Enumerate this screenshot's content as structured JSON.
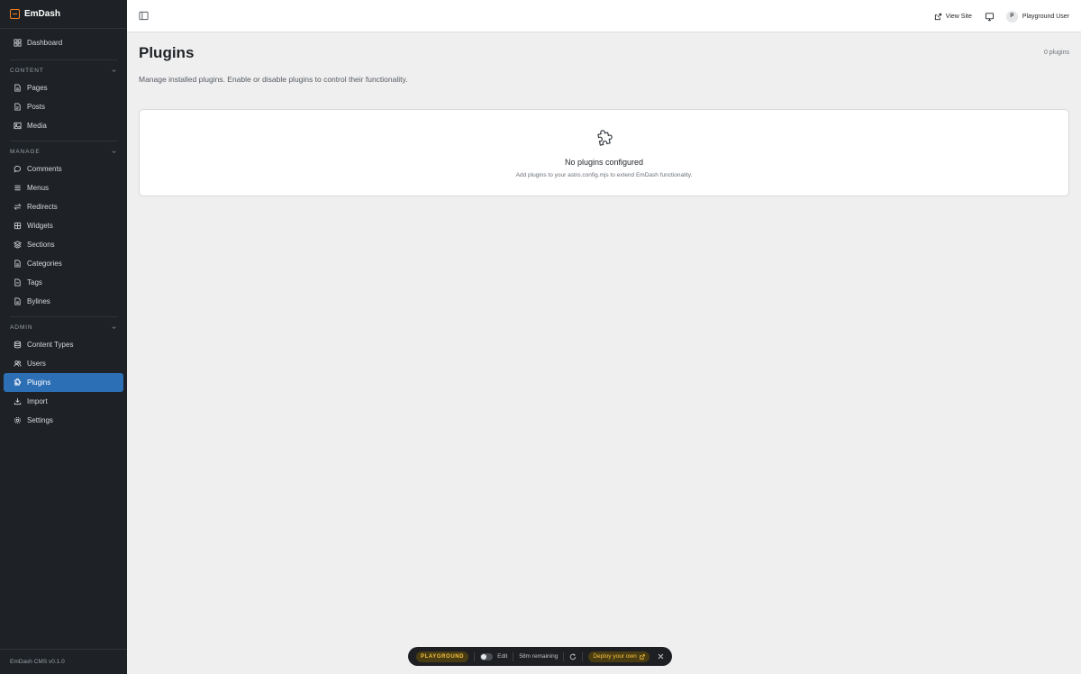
{
  "brand": {
    "name": "EmDash"
  },
  "sidebar": {
    "top_items": [
      {
        "label": "Dashboard",
        "icon": "dashboard-grid-icon"
      }
    ],
    "sections": [
      {
        "title": "CONTENT",
        "items": [
          {
            "label": "Pages",
            "icon": "page-icon"
          },
          {
            "label": "Posts",
            "icon": "post-icon"
          },
          {
            "label": "Media",
            "icon": "image-icon"
          }
        ]
      },
      {
        "title": "MANAGE",
        "items": [
          {
            "label": "Comments",
            "icon": "comment-icon"
          },
          {
            "label": "Menus",
            "icon": "menu-icon"
          },
          {
            "label": "Redirects",
            "icon": "redirect-icon"
          },
          {
            "label": "Widgets",
            "icon": "widget-icon"
          },
          {
            "label": "Sections",
            "icon": "layers-icon"
          },
          {
            "label": "Categories",
            "icon": "category-icon"
          },
          {
            "label": "Tags",
            "icon": "tag-icon"
          },
          {
            "label": "Bylines",
            "icon": "byline-icon"
          }
        ]
      },
      {
        "title": "ADMIN",
        "items": [
          {
            "label": "Content Types",
            "icon": "database-icon"
          },
          {
            "label": "Users",
            "icon": "users-icon"
          },
          {
            "label": "Plugins",
            "icon": "puzzle-icon",
            "active": true
          },
          {
            "label": "Import",
            "icon": "import-icon"
          },
          {
            "label": "Settings",
            "icon": "gear-icon"
          }
        ]
      }
    ],
    "footer": "EmDash CMS v0.1.0"
  },
  "topbar": {
    "view_site": "View Site",
    "user_initial": "P",
    "user_name": "Playground User"
  },
  "main": {
    "title": "Plugins",
    "count": "0 plugins",
    "description": "Manage installed plugins. Enable or disable plugins to control their functionality.",
    "empty_title": "No plugins configured",
    "empty_subtitle": "Add plugins to your astro.config.mjs to extend EmDash functionality."
  },
  "playground": {
    "badge": "PLAYGROUND",
    "edit_label": "Edit",
    "remaining": "58m remaining",
    "deploy_label": "Deploy your own"
  },
  "colors": {
    "sidebar_bg": "#1e2226",
    "active_item": "#2d6fb5",
    "brand_accent": "#f38020",
    "playground_accent": "#f3c242"
  }
}
